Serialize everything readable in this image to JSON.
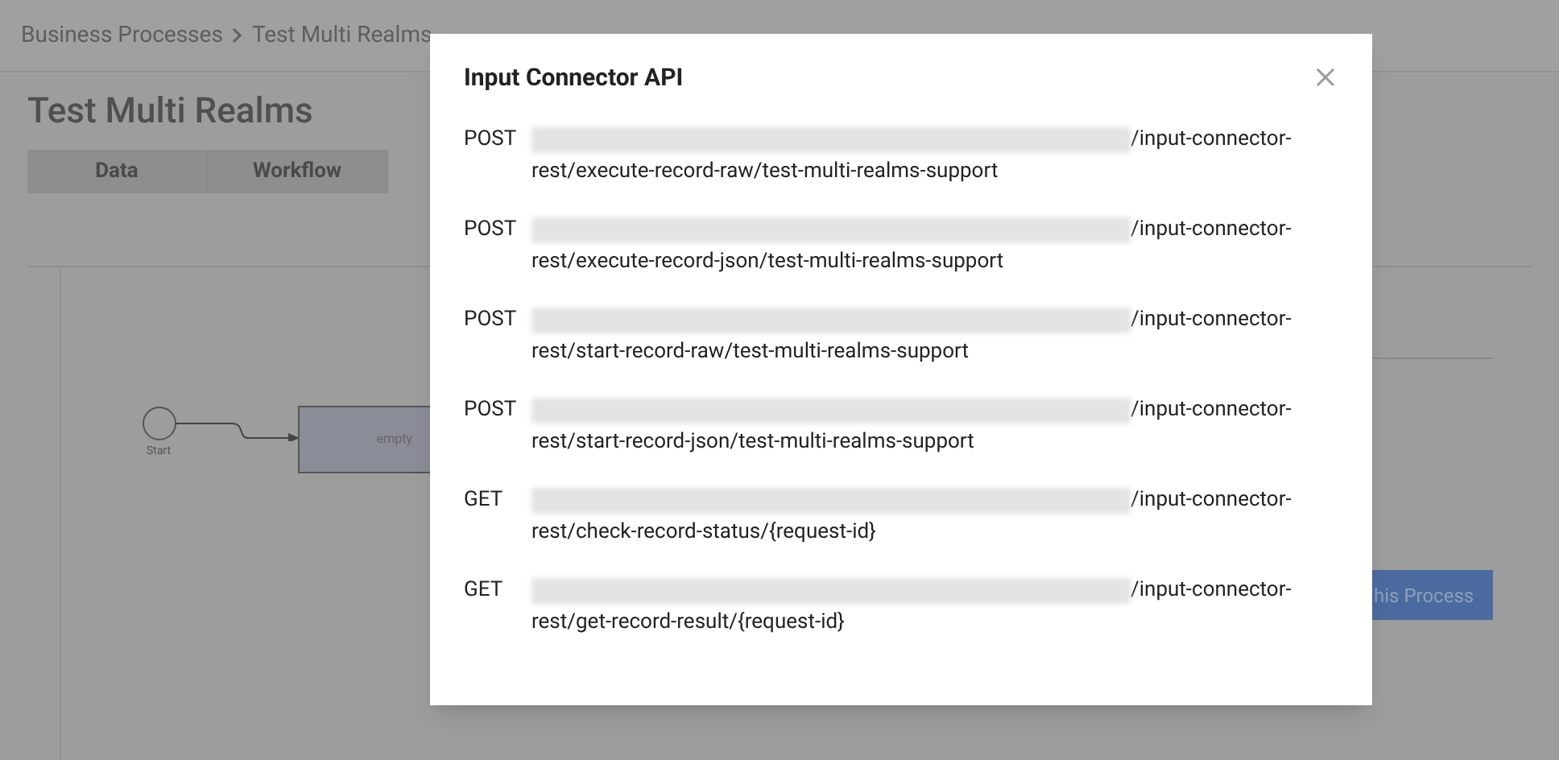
{
  "breadcrumb": [
    "Business Processes",
    "Test Multi Realms"
  ],
  "title": "Test Multi Realms",
  "tabs": [
    {
      "label": "Data",
      "selected": false
    },
    {
      "label": "Workflow",
      "selected": false
    }
  ],
  "diagram": {
    "start_label": "Start",
    "task_label": "empty"
  },
  "action_button": "his Process",
  "dialog": {
    "title": "Input Connector API",
    "endpoints": [
      {
        "method": "POST",
        "url_end": "/input-connector-",
        "url_line_2": "rest/execute-record-raw/test-multi-realms-support"
      },
      {
        "method": "POST",
        "url_end": "/input-connector-",
        "url_line_2": "rest/execute-record-json/test-multi-realms-support"
      },
      {
        "method": "POST",
        "url_end": "/input-connector-",
        "url_line_2": "rest/start-record-raw/test-multi-realms-support"
      },
      {
        "method": "POST",
        "url_end": "/input-connector-",
        "url_line_2": "rest/start-record-json/test-multi-realms-support"
      },
      {
        "method": "GET",
        "url_end": "/input-connector-",
        "url_line_2": "rest/check-record-status/{request-id}"
      },
      {
        "method": "GET",
        "url_end": "/input-connector-",
        "url_line_2": "rest/get-record-result/{request-id}"
      }
    ]
  }
}
